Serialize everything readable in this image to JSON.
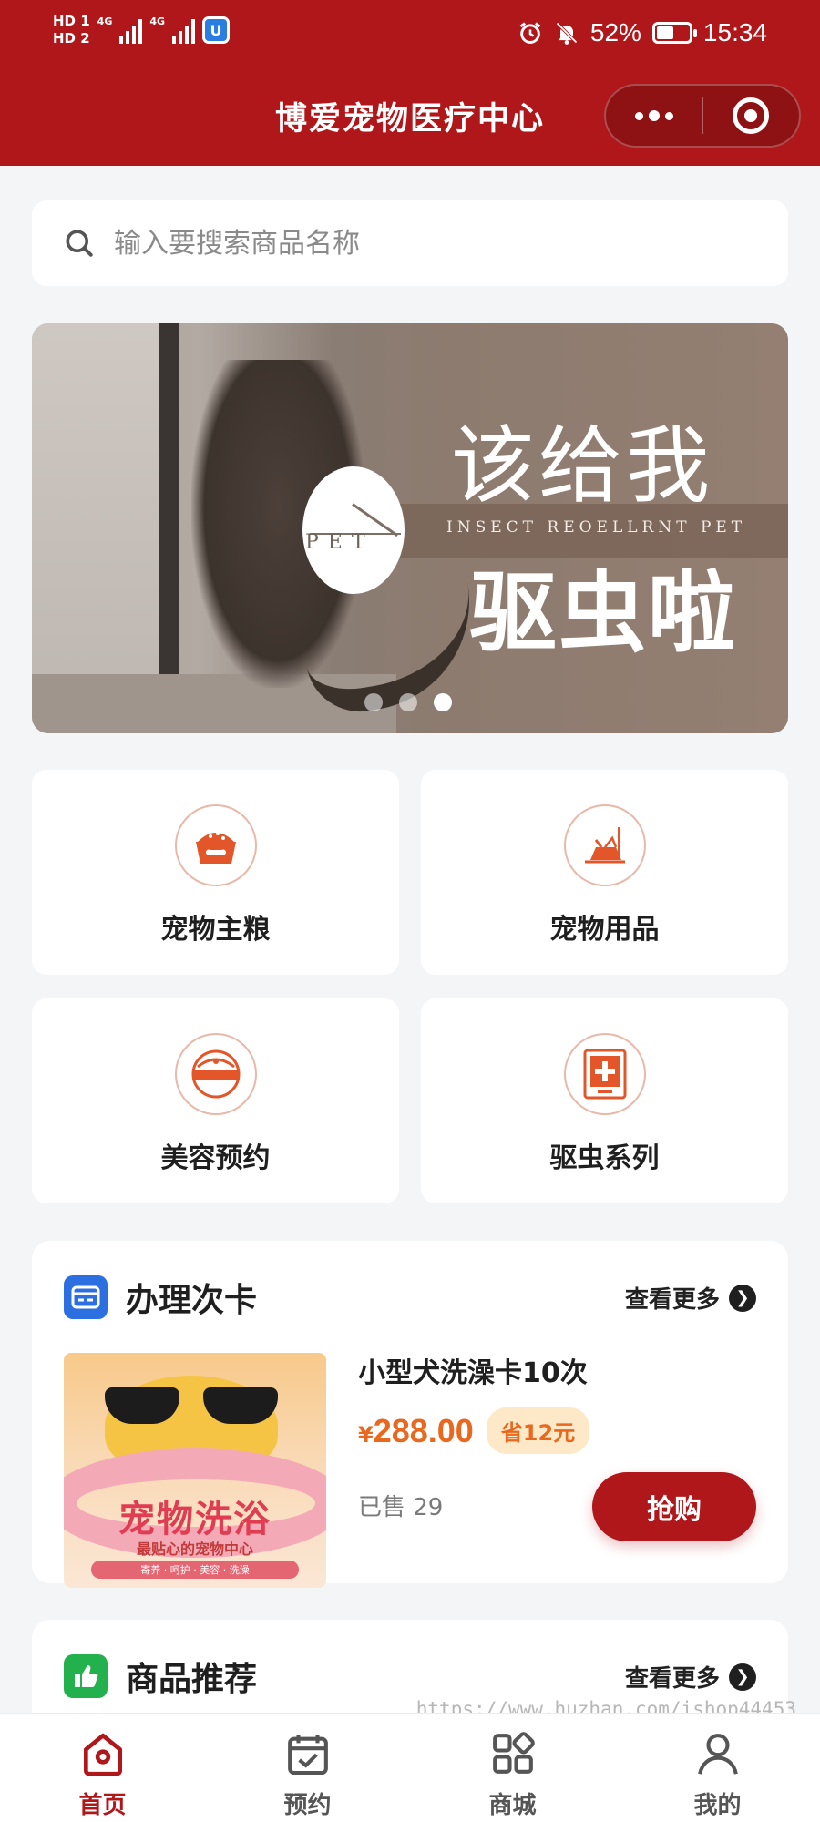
{
  "status_bar": {
    "hd1": "HD 1",
    "hd2": "HD 2",
    "net1": "4G",
    "net2": "4G",
    "battery_percent": "52%",
    "battery_level": 0.52,
    "time": "15:34",
    "icons": [
      "alarm-icon",
      "mute-icon",
      "battery-icon"
    ]
  },
  "header": {
    "title": "博爱宠物医疗中心",
    "accent_color": "#b0171a"
  },
  "search": {
    "placeholder": "输入要搜索商品名称"
  },
  "banner": {
    "line1": "该给我",
    "subtitle": "INSECT REOELLRNT PET",
    "line2": "驱虫啦",
    "logo_text": "PET",
    "active_dot": 3,
    "dot_count": 3
  },
  "categories": [
    {
      "label": "宠物主粮",
      "icon": "pet-food-bowl-icon"
    },
    {
      "label": "宠物用品",
      "icon": "pet-supplies-icon"
    },
    {
      "label": "美容预约",
      "icon": "grooming-icon"
    },
    {
      "label": "驱虫系列",
      "icon": "deworming-icon"
    }
  ],
  "card_section": {
    "title": "办理次卡",
    "more": "查看更多",
    "product": {
      "image_title": "宠物洗浴",
      "image_subtitle": "最贴心的宠物中心",
      "image_tags": "寄养 · 呵护 · 美容 · 洗澡",
      "name": "小型犬洗澡卡10次",
      "currency": "¥",
      "price": "288.00",
      "save": "省12元",
      "sold": "已售 29",
      "buy": "抢购"
    }
  },
  "recommend_section": {
    "title": "商品推荐",
    "more": "查看更多"
  },
  "tabbar": [
    {
      "label": "首页",
      "icon": "home-icon",
      "active": true
    },
    {
      "label": "预约",
      "icon": "calendar-check-icon",
      "active": false
    },
    {
      "label": "商城",
      "icon": "grid-apps-icon",
      "active": false
    },
    {
      "label": "我的",
      "icon": "user-icon",
      "active": false
    }
  ],
  "watermark": "https://www.huzhan.com/ishop44453"
}
